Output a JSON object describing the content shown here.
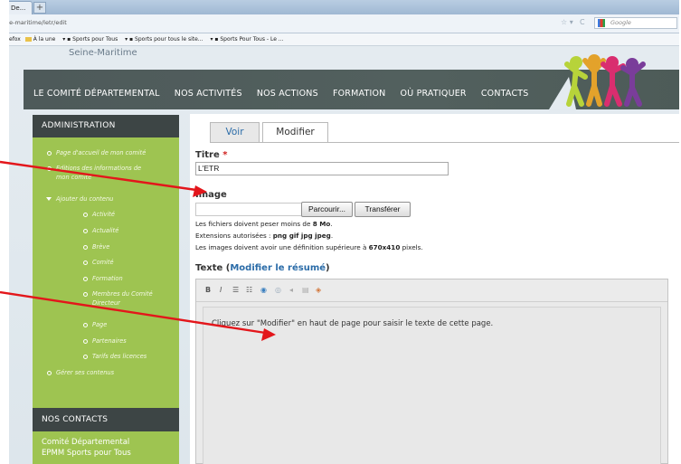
{
  "browser": {
    "tab_title": "De...",
    "new_tab": "+",
    "url": "ne-maritime/letr/edit",
    "search_placeholder": "Google",
    "search_logo_icon": "google-icon",
    "bookmarks": [
      "efox",
      "À la une",
      "Sports pour Tous",
      "Sports pour tous le site...",
      "Sports Pour Tous - Le ..."
    ]
  },
  "site": {
    "name_fragment": "Seine-Maritime"
  },
  "nav": {
    "items": [
      "LE COMITÉ DÉPARTEMENTAL",
      "NOS ACTIVITÉS",
      "NOS ACTIONS",
      "FORMATION",
      "OÙ PRATIQUER",
      "CONTACTS"
    ]
  },
  "sidebar": {
    "admin_title": "ADMINISTRATION",
    "menu": [
      {
        "label": "Page d'accueil de mon comité"
      },
      {
        "label": "Editions des informations de",
        "label2": "mon comité"
      },
      {
        "label": "Ajouter du contenu"
      },
      {
        "label": "Activité"
      },
      {
        "label": "Actualité"
      },
      {
        "label": "Brève"
      },
      {
        "label": "Comité"
      },
      {
        "label": "Formation"
      },
      {
        "label": "Membres du Comité",
        "label2": "Directeur"
      },
      {
        "label": "Page"
      },
      {
        "label": "Partenaires"
      },
      {
        "label": "Tarifs des licences"
      },
      {
        "label": "Gérer ses contenus"
      }
    ],
    "contacts_title": "NOS CONTACTS",
    "contacts_line1": "Comité Départemental",
    "contacts_line2": "EPMM Sports pour Tous"
  },
  "content": {
    "tab_view": "Voir",
    "tab_edit": "Modifier",
    "title_label": "Titre",
    "required_marker": "*",
    "title_value": "L'ETR",
    "image_label": "Image",
    "browse_button": "Parcourir...",
    "upload_button": "Transférer",
    "help1_prefix": "Les fichiers doivent peser moins de ",
    "help1_bold": "8 Mo",
    "help1_suffix": ".",
    "help2_prefix": "Extensions autorisées : ",
    "help2_bold": "png gif jpg jpeg",
    "help2_suffix": ".",
    "help3_prefix": "Les images doivent avoir une définition supérieure à ",
    "help3_bold": "670x410",
    "help3_suffix": " pixels.",
    "texte_label": "Texte (",
    "texte_link": "Modifier le résumé",
    "texte_close": ")",
    "toolbar": [
      "B",
      "I",
      "☰",
      "☷",
      "◉",
      "◎",
      "◂",
      "▤",
      "◈"
    ],
    "editor_text": "Cliquez sur \"Modifier\" en haut de page pour saisir le texte de cette page."
  },
  "colors": {
    "sidebar_green": "#9ec451",
    "header_dark": "#3d4545",
    "link_blue": "#2b6ca8",
    "arrow_red": "#e3161b"
  }
}
